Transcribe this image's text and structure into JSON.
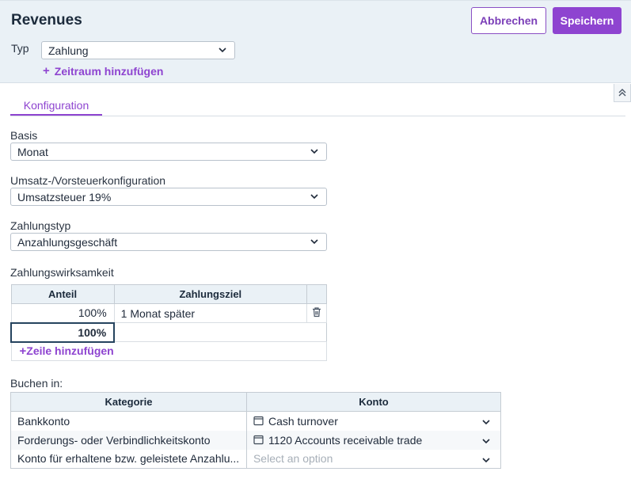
{
  "header": {
    "title": "Revenues",
    "cancel_label": "Abbrechen",
    "save_label": "Speichern",
    "typ_label": "Typ",
    "typ_value": "Zahlung",
    "add_period_label": "Zeitraum hinzufügen"
  },
  "tabs": [
    {
      "label": "Konfiguration",
      "active": true
    }
  ],
  "form": {
    "basis": {
      "label": "Basis",
      "value": "Monat"
    },
    "tax": {
      "label": "Umsatz-/Vorsteuerkonfiguration",
      "value": "Umsatzsteuer 19%"
    },
    "payment_type": {
      "label": "Zahlungstyp",
      "value": "Anzahlungsgeschäft"
    }
  },
  "payment_table": {
    "label": "Zahlungswirksamkeit",
    "columns": [
      "Anteil",
      "Zahlungsziel"
    ],
    "rows": [
      {
        "anteil": "100%",
        "ziel": "1 Monat später"
      }
    ],
    "total": "100%",
    "add_row_label": "Zeile hinzufügen"
  },
  "booking_table": {
    "label": "Buchen in:",
    "columns": [
      "Kategorie",
      "Konto"
    ],
    "rows": [
      {
        "kategorie": "Bankkonto",
        "konto": "Cash turnover",
        "placeholder": false
      },
      {
        "kategorie": "Forderungs- oder Verbindlichkeitskonto",
        "konto": "1120 Accounts receivable trade",
        "placeholder": false
      },
      {
        "kategorie": "Konto für erhaltene bzw. geleistete Anzahlu...",
        "konto": "Select an option",
        "placeholder": true
      }
    ]
  },
  "colors": {
    "accent": "#8e44d0",
    "header_bg": "#eaf1f6"
  }
}
